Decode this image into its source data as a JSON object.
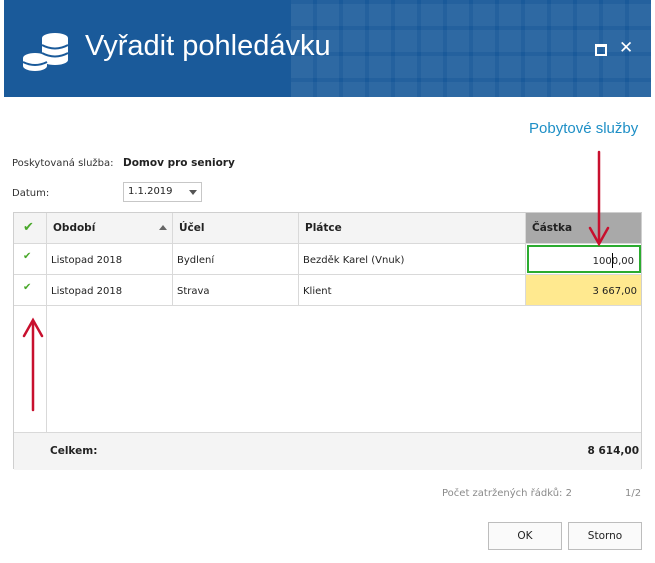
{
  "window": {
    "title": "Vyřadit pohledávku",
    "icon": "coins-icon",
    "accent_color": "#1a5a9a"
  },
  "header_right": "Pobytové služby",
  "form": {
    "service_label": "Poskytovaná služba:",
    "service_value": "Domov pro seniory",
    "date_label": "Datum:",
    "date_value": "1.1.2019"
  },
  "grid": {
    "columns": [
      "Období",
      "Účel",
      "Plátce",
      "Částka"
    ],
    "rows": [
      {
        "checked": true,
        "period": "Listopad 2018",
        "purpose": "Bydlení",
        "payer": "Bezděk Karel (Vnuk)",
        "amount": "1000,00"
      },
      {
        "checked": true,
        "period": "Listopad 2018",
        "purpose": "Strava",
        "payer": "Klient",
        "amount": "3 667,00"
      }
    ],
    "check_glyph": "✔",
    "footer_label": "Celkem:",
    "footer_total": "8 614,00"
  },
  "status": {
    "checked_rows": "Počet zatržených řádků: 2",
    "page": "1/2"
  },
  "buttons": {
    "ok": "OK",
    "cancel": "Storno"
  },
  "annotation_color": "#c8102e"
}
